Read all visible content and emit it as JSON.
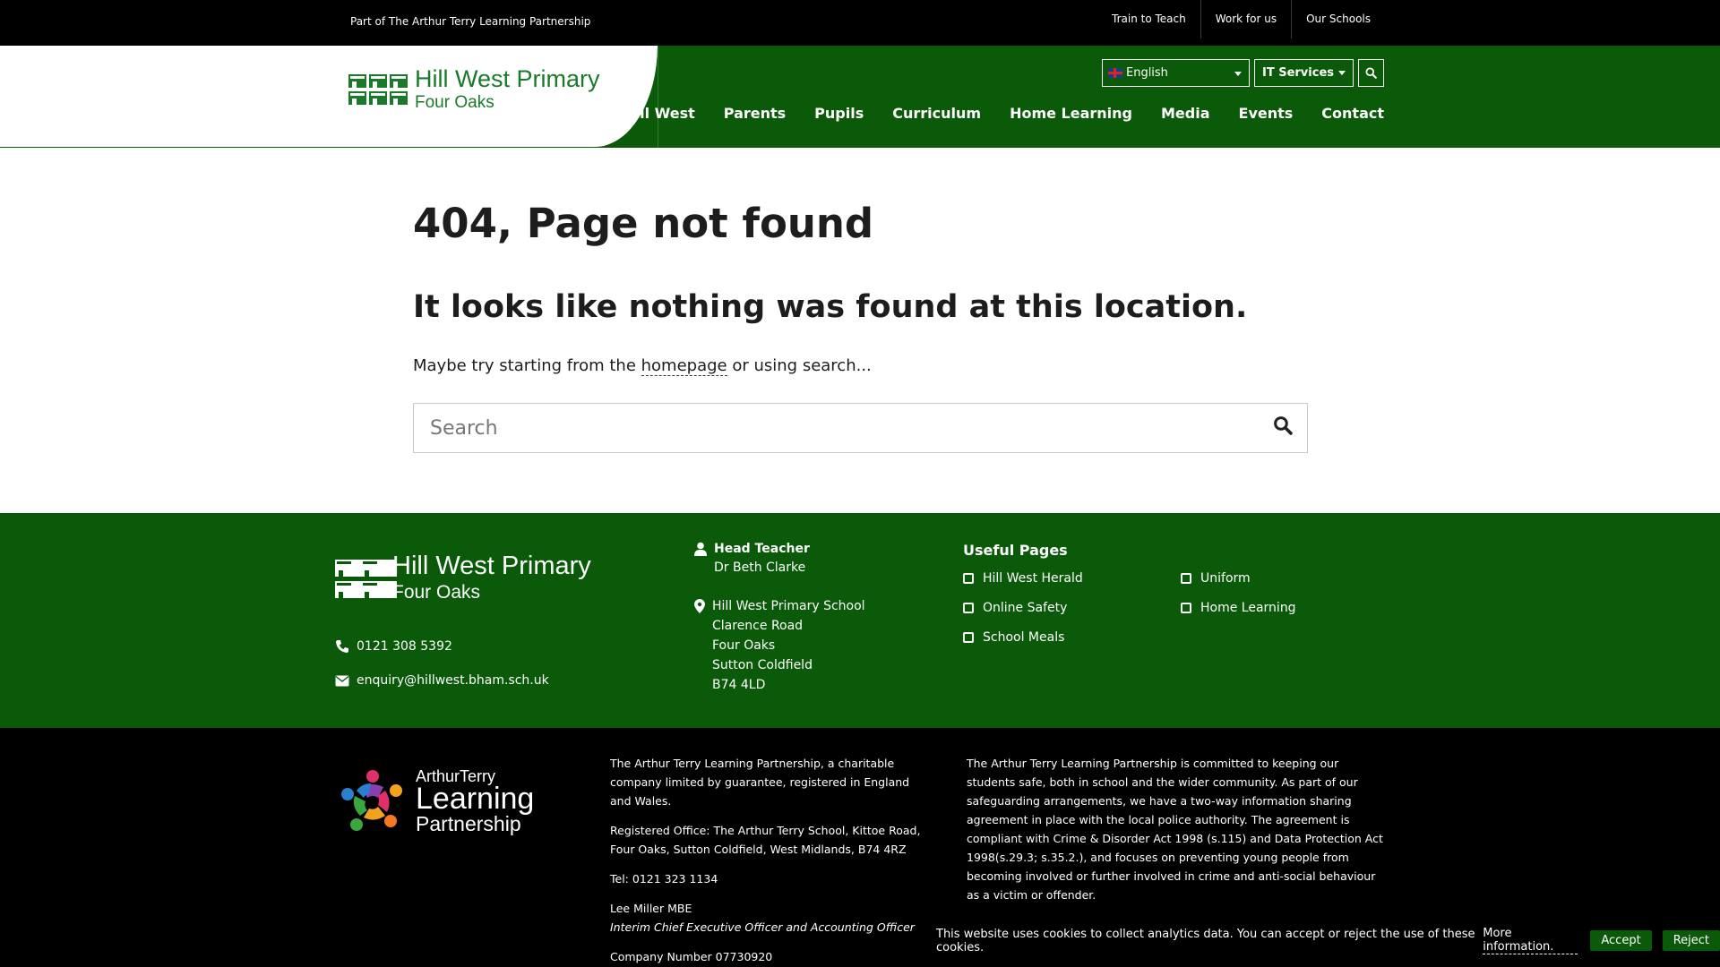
{
  "topbar": {
    "partof": "Part of The Arthur Terry Learning Partnership",
    "links": [
      "Train to Teach",
      "Work for us",
      "Our Schools"
    ]
  },
  "header": {
    "logo_line1": "Hill West Primary",
    "logo_line2": "Four Oaks",
    "language": "English",
    "it_services": "IT Services",
    "nav": [
      "At Hill West",
      "Parents",
      "Pupils",
      "Curriculum",
      "Home Learning",
      "Media",
      "Events",
      "Contact"
    ]
  },
  "main": {
    "title": "404, Page not found",
    "subtitle": "It looks like nothing was found at this location.",
    "text_before": "Maybe try starting from the ",
    "link": "homepage",
    "text_after": " or using search...",
    "search_placeholder": "Search"
  },
  "footer": {
    "logo_line1": "Hill West Primary",
    "logo_line2": "Four Oaks",
    "phone": "0121 308 5392",
    "email": "enquiry@hillwest.bham.sch.uk",
    "head_label": "Head Teacher",
    "head_name": "Dr Beth Clarke",
    "address": [
      "Hill West Primary School",
      "Clarence Road",
      "Four Oaks",
      "Sutton Coldfield",
      "B74 4LD"
    ],
    "useful_title": "Useful Pages",
    "useful": [
      "Hill West Herald",
      "Uniform",
      "Online Safety",
      "Home Learning",
      "School Meals"
    ]
  },
  "bottom": {
    "atlp_1": "ArthurTerry",
    "atlp_2": "Learning",
    "atlp_3": "Partnership",
    "col2_p1": "The Arthur Terry Learning Partnership, a charitable company limited by guarantee, registered in England and Wales.",
    "col2_p2": "Registered Office: The Arthur Terry School, Kittoe Road, Four Oaks, Sutton Coldfield, West Midlands, B74 4RZ",
    "col2_p3": "Tel: 0121 323 1134",
    "col2_name": "Lee Miller MBE",
    "col2_role": "Interim Chief Executive Officer and Accounting Officer",
    "col2_company": "Company Number 07730920",
    "col3": "The Arthur Terry Learning Partnership is committed to keeping our students safe, both in school and the wider community. As part of our safeguarding arrangements, we have a two-way information sharing agreement in place with the local police authority. The agreement is compliant with Crime & Disorder Act 1998 (s.115) and Data Protection Act 1998(s.29.3; s.35.2.), and focuses on preventing young people from becoming involved or further involved in crime and anti-social behaviour as a victim or offender."
  },
  "cookie": {
    "text": "This website uses cookies to collect analytics data. You can accept or reject the use of these cookies.",
    "more": "More information.",
    "accept": "Accept",
    "reject": "Reject"
  }
}
